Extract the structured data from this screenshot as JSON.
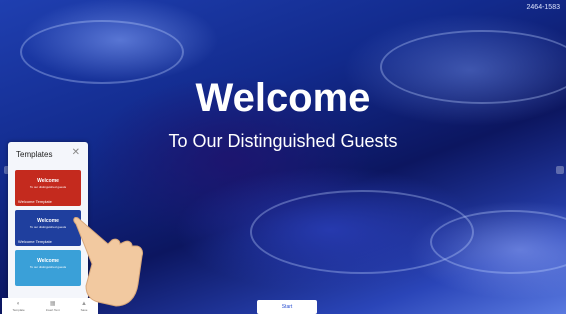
{
  "resolution_label": "2464-1583",
  "slide": {
    "title": "Welcome",
    "subtitle": "To Our Distinguished Guests"
  },
  "templates_panel": {
    "title": "Templates",
    "close_icon": "close-icon",
    "items": [
      {
        "heading": "Welcome",
        "subheading": "To our distinguished guests",
        "caption": "Welcome Template",
        "color": "#c42a1e"
      },
      {
        "heading": "Welcome",
        "subheading": "To our distinguished guests",
        "caption": "Welcome Template",
        "color": "#1f3f9e"
      },
      {
        "heading": "Welcome",
        "subheading": "To our distinguished guests",
        "caption": "",
        "color": "#3aa0d8"
      }
    ]
  },
  "bottom_nav": {
    "items": [
      {
        "label": "Template",
        "icon": "template-icon"
      },
      {
        "label": "Insert Text",
        "icon": "grid-icon"
      },
      {
        "label": "Save",
        "icon": "save-icon"
      }
    ]
  },
  "start_button": "Start",
  "side_handles": [
    "grid-handle-icon",
    "grid-handle-icon"
  ]
}
